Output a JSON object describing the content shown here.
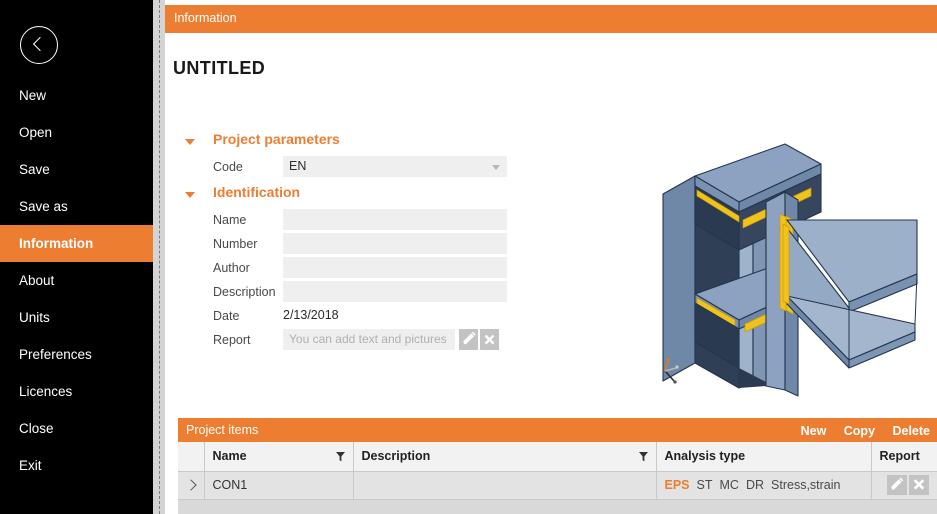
{
  "sidebar": {
    "back_icon": "chevron-left-icon",
    "items": [
      {
        "label": "New",
        "active": false
      },
      {
        "label": "Open",
        "active": false
      },
      {
        "label": "Save",
        "active": false
      },
      {
        "label": "Save as",
        "active": false
      },
      {
        "label": "Information",
        "active": true
      },
      {
        "label": "About",
        "active": false
      },
      {
        "label": "Units",
        "active": false
      },
      {
        "label": "Preferences",
        "active": false
      },
      {
        "label": "Licences",
        "active": false
      },
      {
        "label": "Close",
        "active": false
      },
      {
        "label": "Exit",
        "active": false
      }
    ]
  },
  "topbar": {
    "label": "Information"
  },
  "page": {
    "title": "UNTITLED"
  },
  "form": {
    "project_parameters": {
      "heading": "Project parameters",
      "code": {
        "label": "Code",
        "value": "EN",
        "arrow_icon": "chevron-down-icon"
      }
    },
    "identification": {
      "heading": "Identification",
      "name": {
        "label": "Name",
        "value": ""
      },
      "number": {
        "label": "Number",
        "value": ""
      },
      "author": {
        "label": "Author",
        "value": ""
      },
      "description": {
        "label": "Description",
        "value": ""
      },
      "date": {
        "label": "Date",
        "value": "2/13/2018"
      },
      "report": {
        "label": "Report",
        "placeholder": "You can add text and pictures",
        "edit_icon": "pencil-icon",
        "delete_icon": "close-x-icon"
      }
    }
  },
  "viewport": {
    "model": "steel-beam-to-column-connection",
    "axis_indicator": "coordinate-axis-triad",
    "colors": {
      "steel_light": "#93a9c4",
      "steel_mid": "#7e96b5",
      "steel_dark": "#2f3f55",
      "weld": "#f2c21c",
      "outline": "#23364d"
    }
  },
  "project_items": {
    "title": "Project items",
    "actions": [
      "New",
      "Copy",
      "Delete"
    ],
    "columns": [
      "",
      "Name",
      "Description",
      "Analysis type",
      "Report"
    ],
    "filter_icon": "funnel-icon",
    "rows": [
      {
        "expand_icon": "chevron-right-icon",
        "name": "CON1",
        "description": "",
        "analysis": [
          {
            "text": "EPS",
            "active": true
          },
          {
            "text": "ST",
            "active": false
          },
          {
            "text": "MC",
            "active": false
          },
          {
            "text": "DR",
            "active": false
          },
          {
            "text": "Stress,strain",
            "active": false
          }
        ],
        "report_edit_icon": "pencil-icon",
        "report_delete_icon": "close-x-icon"
      }
    ]
  },
  "theme": {
    "accent": "#ed7d31",
    "sidebar_bg": "#000000",
    "field_bg": "#efefef",
    "grid_row_bg": "#e3e3e3"
  }
}
